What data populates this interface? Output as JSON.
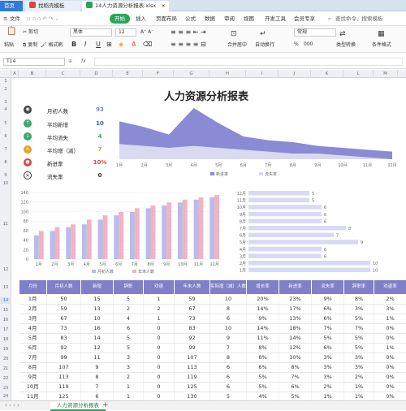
{
  "tabs": {
    "home": "首页",
    "template": "找稻壳模板",
    "file": "14人力资源分析报表.xlsx"
  },
  "menu": {
    "file": "文件",
    "start": "开始",
    "insert": "插入",
    "layout": "页面布局",
    "formula": "公式",
    "data": "数据",
    "review": "审阅",
    "view": "视图",
    "dev": "开发工具",
    "member": "会员专享",
    "search": "查找命令、搜索模板"
  },
  "ribbon": {
    "paste": "粘贴",
    "cut": "剪切",
    "copy": "复制",
    "format_painter": "格式刷",
    "font": "黑体",
    "size": "12",
    "bold": "B",
    "italic": "I",
    "underline": "U",
    "merge": "合并居中",
    "wrap": "自动换行",
    "number_format": "常规",
    "percent": "%",
    "thousands": "000",
    "type_convert": "类型转换",
    "cond_format": "条件格式"
  },
  "formula_bar": {
    "cell_ref": "T14",
    "fx": "fx",
    "value": ""
  },
  "columns": [
    "A",
    "B",
    "C",
    "D",
    "E",
    "F",
    "G",
    "H",
    "I",
    "J",
    "K",
    "L",
    "M"
  ],
  "rows": [
    "1",
    "2",
    "3",
    "4",
    "5",
    "6",
    "7",
    "8",
    "9",
    "10",
    "11",
    "12",
    "13",
    "14",
    "15",
    "16",
    "17",
    "18",
    "19",
    "20",
    "21",
    "22",
    "23",
    "24",
    "25"
  ],
  "dashboard": {
    "title": "人力资源分析报表",
    "kpis": [
      {
        "label": "月初人数",
        "value": "93",
        "color": "#7e80c8",
        "icon": "people"
      },
      {
        "label": "平均新增",
        "value": "10",
        "color": "#3aa86b",
        "icon": "arrow-up"
      },
      {
        "label": "平均流失",
        "value": "4",
        "color": "#3aa86b",
        "icon": "arrow-down"
      },
      {
        "label": "平均增（减）",
        "value": "7",
        "color": "#e8a21f",
        "icon": "plus-minus"
      },
      {
        "label": "新进率",
        "value": "10%",
        "color": "#d9473f",
        "icon": "new"
      },
      {
        "label": "流失率",
        "value": "0",
        "color": "#333333",
        "icon": "x"
      }
    ]
  },
  "chart_data": [
    {
      "type": "area",
      "categories": [
        "1月",
        "2月",
        "3月",
        "4月",
        "5月",
        "6月",
        "7月",
        "8月",
        "9月",
        "10月",
        "11月",
        "12月"
      ],
      "series": [
        {
          "name": "新进率",
          "values": [
            20,
            17,
            13,
            27,
            19,
            12,
            10,
            9,
            7,
            6,
            5,
            4
          ],
          "color": "#8a8bd4"
        },
        {
          "name": "流失率",
          "values": [
            8,
            7,
            6,
            7,
            6,
            5,
            4,
            3,
            3,
            2,
            1,
            0
          ],
          "color": "#d8daf1"
        }
      ],
      "ylim": [
        0,
        30
      ]
    },
    {
      "type": "bar",
      "categories": [
        "1月",
        "2月",
        "3月",
        "4月",
        "5月",
        "6月",
        "7月",
        "8月",
        "9月",
        "10月",
        "11月",
        "12月"
      ],
      "series": [
        {
          "name": "月初人数",
          "values": [
            50,
            59,
            67,
            73,
            83,
            92,
            99,
            107,
            113,
            119,
            125,
            130
          ],
          "color": "#b9bce8"
        },
        {
          "name": "年末人数",
          "values": [
            59,
            67,
            73,
            83,
            92,
            99,
            107,
            113,
            119,
            125,
            130,
            135
          ],
          "color": "#efb3c4"
        }
      ],
      "ylim": [
        0,
        140
      ],
      "yticks": [
        0,
        20,
        40,
        60,
        80,
        100,
        120,
        140
      ]
    },
    {
      "type": "bar",
      "orientation": "horizontal",
      "categories": [
        "12月",
        "11月",
        "10月",
        "9月",
        "8月",
        "7月",
        "6月",
        "5月",
        "4月",
        "3月",
        "2月",
        "1月"
      ],
      "values": [
        5,
        5,
        6,
        6,
        6,
        8,
        7,
        9,
        6,
        6,
        10,
        10
      ],
      "color": "#d8daf1"
    }
  ],
  "table": {
    "headers": [
      "月份",
      "月初人数",
      "新增",
      "辞职",
      "劝退",
      "年末人数",
      "实际增（减）人数",
      "增长率",
      "新进率",
      "流失率",
      "辞职率",
      "劝退率"
    ],
    "rows": [
      [
        "1月",
        "50",
        "15",
        "5",
        "1",
        "59",
        "10",
        "20%",
        "23%",
        "9%",
        "8%",
        "2%"
      ],
      [
        "2月",
        "59",
        "13",
        "2",
        "2",
        "67",
        "8",
        "14%",
        "17%",
        "6%",
        "3%",
        "3%"
      ],
      [
        "3月",
        "67",
        "10",
        "4",
        "1",
        "73",
        "6",
        "9%",
        "13%",
        "6%",
        "5%",
        "1%"
      ],
      [
        "4月",
        "73",
        "16",
        "6",
        "0",
        "83",
        "10",
        "14%",
        "18%",
        "7%",
        "7%",
        "0%"
      ],
      [
        "5月",
        "83",
        "14",
        "5",
        "0",
        "92",
        "9",
        "11%",
        "14%",
        "5%",
        "5%",
        "0%"
      ],
      [
        "6月",
        "92",
        "12",
        "5",
        "0",
        "99",
        "7",
        "8%",
        "12%",
        "6%",
        "5%",
        "1%"
      ],
      [
        "7月",
        "99",
        "11",
        "3",
        "0",
        "107",
        "8",
        "8%",
        "10%",
        "3%",
        "3%",
        "0%"
      ],
      [
        "8月",
        "107",
        "9",
        "3",
        "0",
        "113",
        "6",
        "6%",
        "8%",
        "3%",
        "3%",
        "0%"
      ],
      [
        "9月",
        "113",
        "8",
        "2",
        "0",
        "119",
        "6",
        "5%",
        "7%",
        "3%",
        "2%",
        "0%"
      ],
      [
        "10月",
        "119",
        "7",
        "1",
        "0",
        "125",
        "6",
        "5%",
        "6%",
        "2%",
        "1%",
        "0%"
      ],
      [
        "11月",
        "125",
        "6",
        "1",
        "0",
        "130",
        "5",
        "4%",
        "5%",
        "1%",
        "1%",
        "0%"
      ],
      [
        "12月",
        "130",
        "6",
        "1",
        "0",
        "135",
        "5",
        "4%",
        "4%",
        "1%",
        "1%",
        "0%"
      ]
    ]
  },
  "sheet_tabs": {
    "active": "人力资源分析报表",
    "add": "+"
  }
}
